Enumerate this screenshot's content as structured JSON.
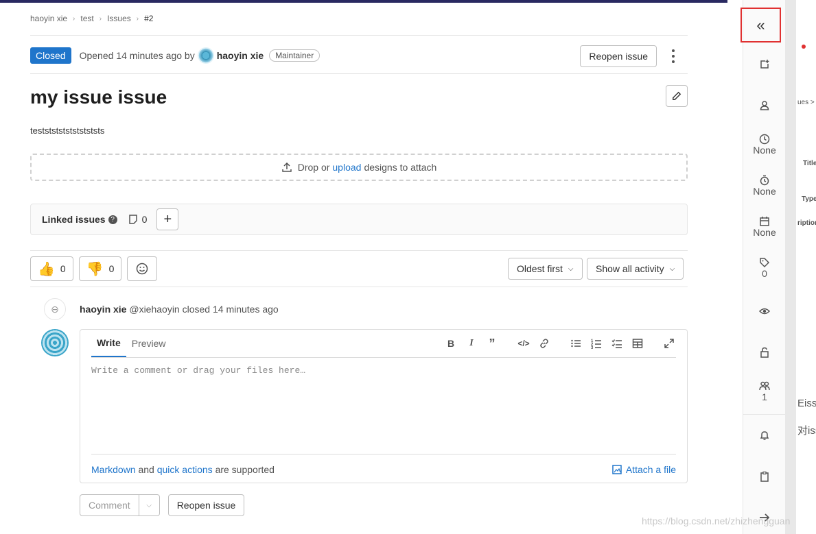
{
  "breadcrumb": [
    "haoyin xie",
    "test",
    "Issues",
    "#2"
  ],
  "status_badge": "Closed",
  "opened_text": "Opened 14 minutes ago by",
  "author": "haoyin xie",
  "author_role": "Maintainer",
  "reopen_label": "Reopen issue",
  "issue_title": "my issue issue",
  "description": "testststststststststs",
  "dropzone": {
    "prefix": "Drop or",
    "link": "upload",
    "suffix": "designs to attach"
  },
  "linked_issues": {
    "label": "Linked issues",
    "count": "0"
  },
  "awards": {
    "thumbs_up": "0",
    "thumbs_down": "0"
  },
  "sort": {
    "order": "Oldest first",
    "filter": "Show all activity"
  },
  "activity_note": {
    "author": "haoyin xie",
    "username": "@xiehaoyin",
    "action": "closed 14 minutes ago"
  },
  "editor": {
    "tab_write": "Write",
    "tab_preview": "Preview",
    "placeholder": "Write a comment or drag your files here…",
    "markdown_link": "Markdown",
    "and_text": "and",
    "quick_actions_link": "quick actions",
    "supported_text": "are supported",
    "attach_label": "Attach a file"
  },
  "actions": {
    "comment": "Comment",
    "reopen": "Reopen issue"
  },
  "sidebar": {
    "time_estimate": "None",
    "time_spent": "None",
    "due_date": "None",
    "labels_count": "0",
    "participants_count": "1"
  },
  "background_window": {
    "t1": "Title",
    "t2": "Type",
    "t3": "ription",
    "t4": "Eiss",
    "t5": "对iss",
    "t6": "ues >"
  },
  "watermark": "https://blog.csdn.net/zhizhengguan"
}
